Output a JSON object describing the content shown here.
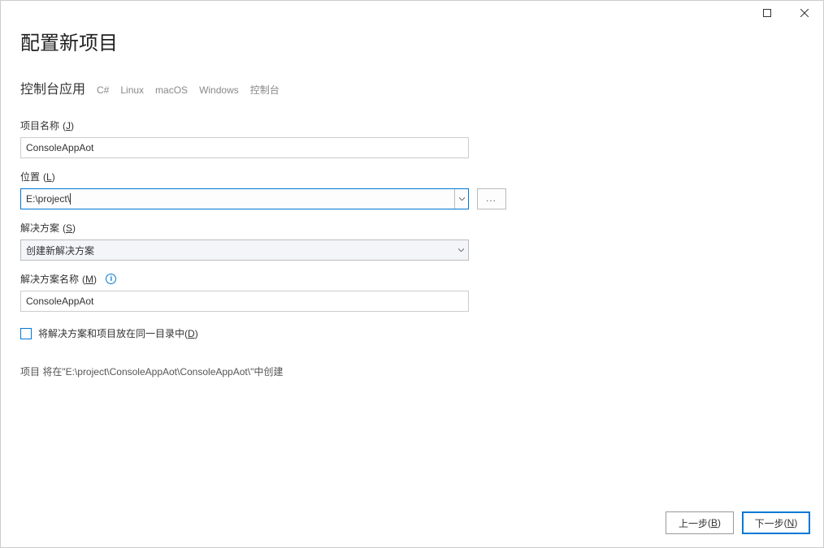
{
  "heading": "配置新项目",
  "template_name": "控制台应用",
  "tags": [
    "C#",
    "Linux",
    "macOS",
    "Windows",
    "控制台"
  ],
  "labels": {
    "project_name": "项目名称",
    "project_name_sc": "J",
    "location": "位置",
    "location_sc": "L",
    "solution": "解决方案",
    "solution_sc": "S",
    "solution_name": "解决方案名称",
    "solution_name_sc": "M",
    "same_dir": "将解决方案和项目放在同一目录中",
    "same_dir_sc": "D"
  },
  "values": {
    "project_name": "ConsoleAppAot",
    "location": "E:\\project\\",
    "solution": "创建新解决方案",
    "solution_name": "ConsoleAppAot",
    "same_dir_checked": false
  },
  "note": "项目 将在\"E:\\project\\ConsoleAppAot\\ConsoleAppAot\\\"中创建",
  "browse": "...",
  "buttons": {
    "back": "上一步",
    "back_sc": "B",
    "next": "下一步",
    "next_sc": "N"
  }
}
